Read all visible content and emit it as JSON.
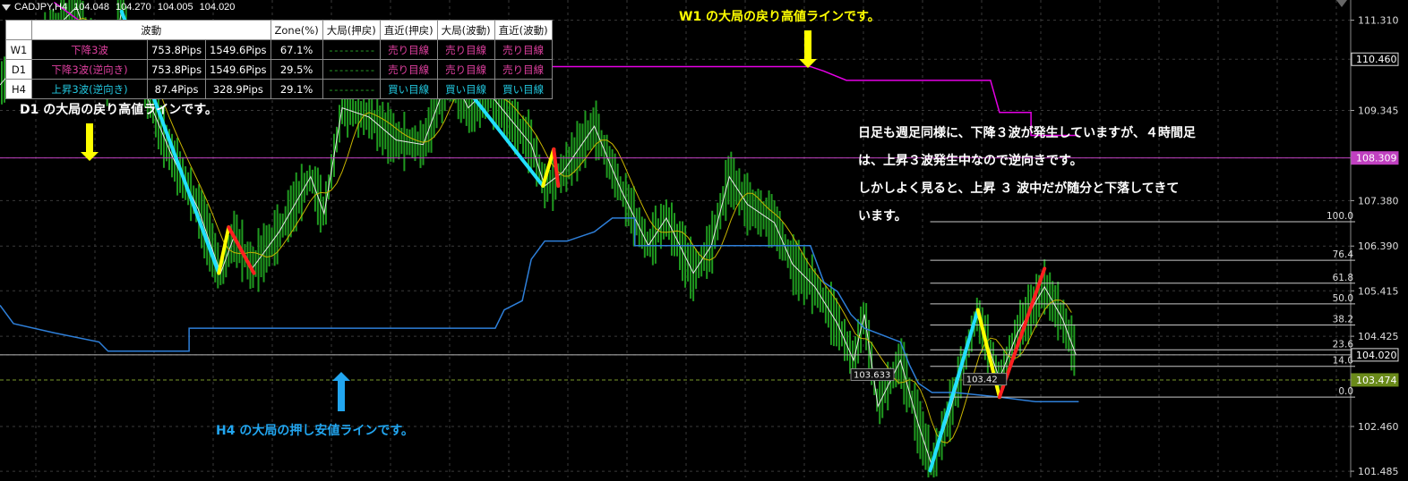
{
  "header": {
    "symbol": "CADJPY,H4",
    "open": "104.048",
    "high": "104.270",
    "low": "104.005",
    "close": "104.020"
  },
  "table": {
    "headers": [
      "波動",
      "Zone(%)",
      "大局(押戻)",
      "直近(押戻)",
      "大局(波動)",
      "直近(波動)"
    ],
    "rows": [
      {
        "tf": "W1",
        "wave": "下降3波",
        "pips1": "753.8Pips",
        "pips2": "1549.6Pips",
        "zone": "67.1%",
        "big_pull": "- - - - - - - - -",
        "near_pull": "売り目線",
        "big_wave": "売り目線",
        "near_wave": "売り目線",
        "wave_color": "#e040a0",
        "near_color": "#e040a0",
        "bigw_color": "#e040a0",
        "nearw_color": "#e040a0"
      },
      {
        "tf": "D1",
        "wave": "下降3波(逆向き)",
        "pips1": "753.8Pips",
        "pips2": "1549.6Pips",
        "zone": "29.5%",
        "big_pull": "- - - - - - - - -",
        "near_pull": "売り目線",
        "big_wave": "売り目線",
        "near_wave": "売り目線",
        "wave_color": "#e040a0",
        "near_color": "#e040a0",
        "bigw_color": "#e040a0",
        "nearw_color": "#e040a0"
      },
      {
        "tf": "H4",
        "wave": "上昇3波(逆向き)",
        "pips1": "87.4Pips",
        "pips2": "328.9Pips",
        "zone": "29.1%",
        "big_pull": "- - - - - - - - -",
        "near_pull": "買い目線",
        "big_wave": "買い目線",
        "near_wave": "買い目線",
        "wave_color": "#22c8e0",
        "near_color": "#22c8e0",
        "bigw_color": "#22c8e0",
        "nearw_color": "#22c8e0"
      }
    ]
  },
  "annotations": {
    "w1": "W1 の大局の戻り高値ラインです。",
    "d1": "D1 の大局の戻り高値ラインです。",
    "h4": "H4 の大局の押し安値ラインです。",
    "note_lines": [
      "日足も週足同様に、下降３波が発生していますが、４時間足",
      "は、上昇３波発生中なので逆向きです。",
      "しかしよく見ると、上昇 ３ 波中だが随分と下落してきて",
      "います。"
    ]
  },
  "colors": {
    "w1_line": "#e600e6",
    "d1_line": "#c040c0",
    "h4_line": "#2e7fd9",
    "wave_up": "#22e0ff",
    "wave_mid": "#ffff00",
    "wave_down": "#ff2020",
    "candles": "#1f9a1f",
    "ma": "#c8b400"
  },
  "chart_data": {
    "type": "line",
    "symbol": "CADJPY",
    "timeframe": "H4",
    "y_ticks": [
      "111.310",
      "110.460",
      "109.345",
      "108.309",
      "107.380",
      "106.390",
      "105.415",
      "104.425",
      "104.020",
      "103.474",
      "102.460",
      "101.485"
    ],
    "price_labels": [
      {
        "value": 110.46,
        "text": "110.460",
        "style": "box-dark"
      },
      {
        "value": 108.309,
        "text": "108.309",
        "style": "box-purple"
      },
      {
        "value": 104.02,
        "text": "104.020",
        "style": "box-dark"
      },
      {
        "value": 103.474,
        "text": "103.474",
        "style": "box-green"
      }
    ],
    "ylim": [
      101.35,
      111.75
    ],
    "x_count": 1500,
    "price_series": [
      [
        0,
        109.9
      ],
      [
        30,
        110.6
      ],
      [
        60,
        111.1
      ],
      [
        85,
        111.6
      ],
      [
        100,
        110.7
      ],
      [
        120,
        110.0
      ],
      [
        135,
        111.5
      ],
      [
        160,
        109.8
      ],
      [
        190,
        108.4
      ],
      [
        220,
        107.2
      ],
      [
        245,
        105.8
      ],
      [
        260,
        106.6
      ],
      [
        280,
        105.9
      ],
      [
        310,
        106.7
      ],
      [
        345,
        107.9
      ],
      [
        360,
        107.1
      ],
      [
        380,
        109.4
      ],
      [
        410,
        109.2
      ],
      [
        440,
        108.7
      ],
      [
        470,
        108.6
      ],
      [
        500,
        110.2
      ],
      [
        520,
        109.4
      ],
      [
        540,
        109.8
      ],
      [
        565,
        109.2
      ],
      [
        590,
        108.6
      ],
      [
        605,
        107.7
      ],
      [
        625,
        108.0
      ],
      [
        660,
        109.0
      ],
      [
        690,
        107.6
      ],
      [
        720,
        106.4
      ],
      [
        740,
        107.0
      ],
      [
        770,
        105.8
      ],
      [
        790,
        106.4
      ],
      [
        810,
        107.9
      ],
      [
        830,
        107.3
      ],
      [
        860,
        106.9
      ],
      [
        880,
        106.0
      ],
      [
        905,
        105.5
      ],
      [
        930,
        104.7
      ],
      [
        948,
        103.9
      ],
      [
        960,
        104.9
      ],
      [
        975,
        102.9
      ],
      [
        1000,
        103.9
      ],
      [
        1020,
        102.5
      ],
      [
        1035,
        101.6
      ],
      [
        1055,
        102.8
      ],
      [
        1085,
        104.9
      ],
      [
        1110,
        103.5
      ],
      [
        1130,
        104.5
      ],
      [
        1160,
        105.5
      ],
      [
        1180,
        104.8
      ],
      [
        1195,
        104.02
      ]
    ],
    "waves": [
      {
        "color": "wave_up",
        "points": [
          [
            135,
            111.5
          ],
          [
            243,
            105.8
          ]
        ]
      },
      {
        "color": "wave_mid",
        "points": [
          [
            243,
            105.8
          ],
          [
            254,
            106.8
          ]
        ]
      },
      {
        "color": "wave_down",
        "points": [
          [
            254,
            106.8
          ],
          [
            282,
            105.8
          ]
        ]
      },
      {
        "color": "wave_up",
        "points": [
          [
            503,
            110.2
          ],
          [
            603,
            107.7
          ]
        ]
      },
      {
        "color": "wave_mid",
        "points": [
          [
            603,
            107.7
          ],
          [
            615,
            108.5
          ]
        ]
      },
      {
        "color": "wave_down",
        "points": [
          [
            615,
            108.5
          ],
          [
            620,
            107.7
          ]
        ]
      },
      {
        "color": "wave_up",
        "points": [
          [
            1033,
            101.5
          ],
          [
            1086,
            105.0
          ]
        ]
      },
      {
        "color": "wave_mid",
        "points": [
          [
            1086,
            105.0
          ],
          [
            1110,
            103.1
          ]
        ]
      },
      {
        "color": "wave_down",
        "points": [
          [
            1110,
            103.1
          ],
          [
            1160,
            105.9
          ]
        ]
      }
    ],
    "levels": {
      "w1": [
        [
          60,
          111.7
        ],
        [
          95,
          111.2
        ],
        [
          110,
          110.1
        ],
        [
          260,
          110.1
        ],
        [
          500,
          110.1
        ],
        [
          500,
          110.3
        ],
        [
          580,
          110.3
        ],
        [
          620,
          110.3
        ],
        [
          900,
          110.3
        ],
        [
          915,
          110.2
        ],
        [
          940,
          110.0
        ],
        [
          1100,
          110.0
        ],
        [
          1110,
          109.3
        ],
        [
          1145,
          109.3
        ],
        [
          1145,
          108.8
        ],
        [
          1198,
          108.8
        ]
      ],
      "d1": [
        [
          0,
          108.309
        ],
        [
          1508,
          108.309
        ]
      ],
      "h4": [
        [
          0,
          105.1
        ],
        [
          15,
          104.7
        ],
        [
          60,
          104.5
        ],
        [
          110,
          104.3
        ],
        [
          120,
          104.1
        ],
        [
          210,
          104.1
        ],
        [
          210,
          104.6
        ],
        [
          550,
          104.6
        ],
        [
          560,
          105.0
        ],
        [
          580,
          105.2
        ],
        [
          590,
          106.1
        ],
        [
          605,
          106.5
        ],
        [
          630,
          106.5
        ],
        [
          660,
          106.7
        ],
        [
          680,
          107.0
        ],
        [
          705,
          107.0
        ],
        [
          705,
          106.4
        ],
        [
          900,
          106.4
        ],
        [
          915,
          105.6
        ],
        [
          930,
          105.4
        ],
        [
          945,
          104.9
        ],
        [
          960,
          104.6
        ],
        [
          1000,
          104.3
        ],
        [
          1010,
          103.8
        ],
        [
          1020,
          103.4
        ],
        [
          1035,
          103.2
        ],
        [
          1060,
          103.2
        ],
        [
          1110,
          103.1
        ],
        [
          1150,
          103.0
        ],
        [
          1198,
          103.0
        ]
      ],
      "close_line": 104.02,
      "dashed_green": 103.474
    },
    "fibo": {
      "x_start": 1033,
      "x_end": 1505,
      "levels": [
        {
          "label": "100.0",
          "value": 106.92
        },
        {
          "label": "76.4",
          "value": 106.08
        },
        {
          "label": "61.8",
          "value": 105.58
        },
        {
          "label": "50.0",
          "value": 105.13
        },
        {
          "label": "38.2",
          "value": 104.67
        },
        {
          "label": "23.6",
          "value": 104.13
        },
        {
          "label": "14.0",
          "value": 103.77
        },
        {
          "label": "0.0",
          "value": 103.1
        }
      ]
    },
    "price_tags": [
      {
        "x": 945,
        "value": 103.6,
        "text": "103.633"
      },
      {
        "x": 1070,
        "value": 103.5,
        "text": "103.42"
      }
    ]
  }
}
